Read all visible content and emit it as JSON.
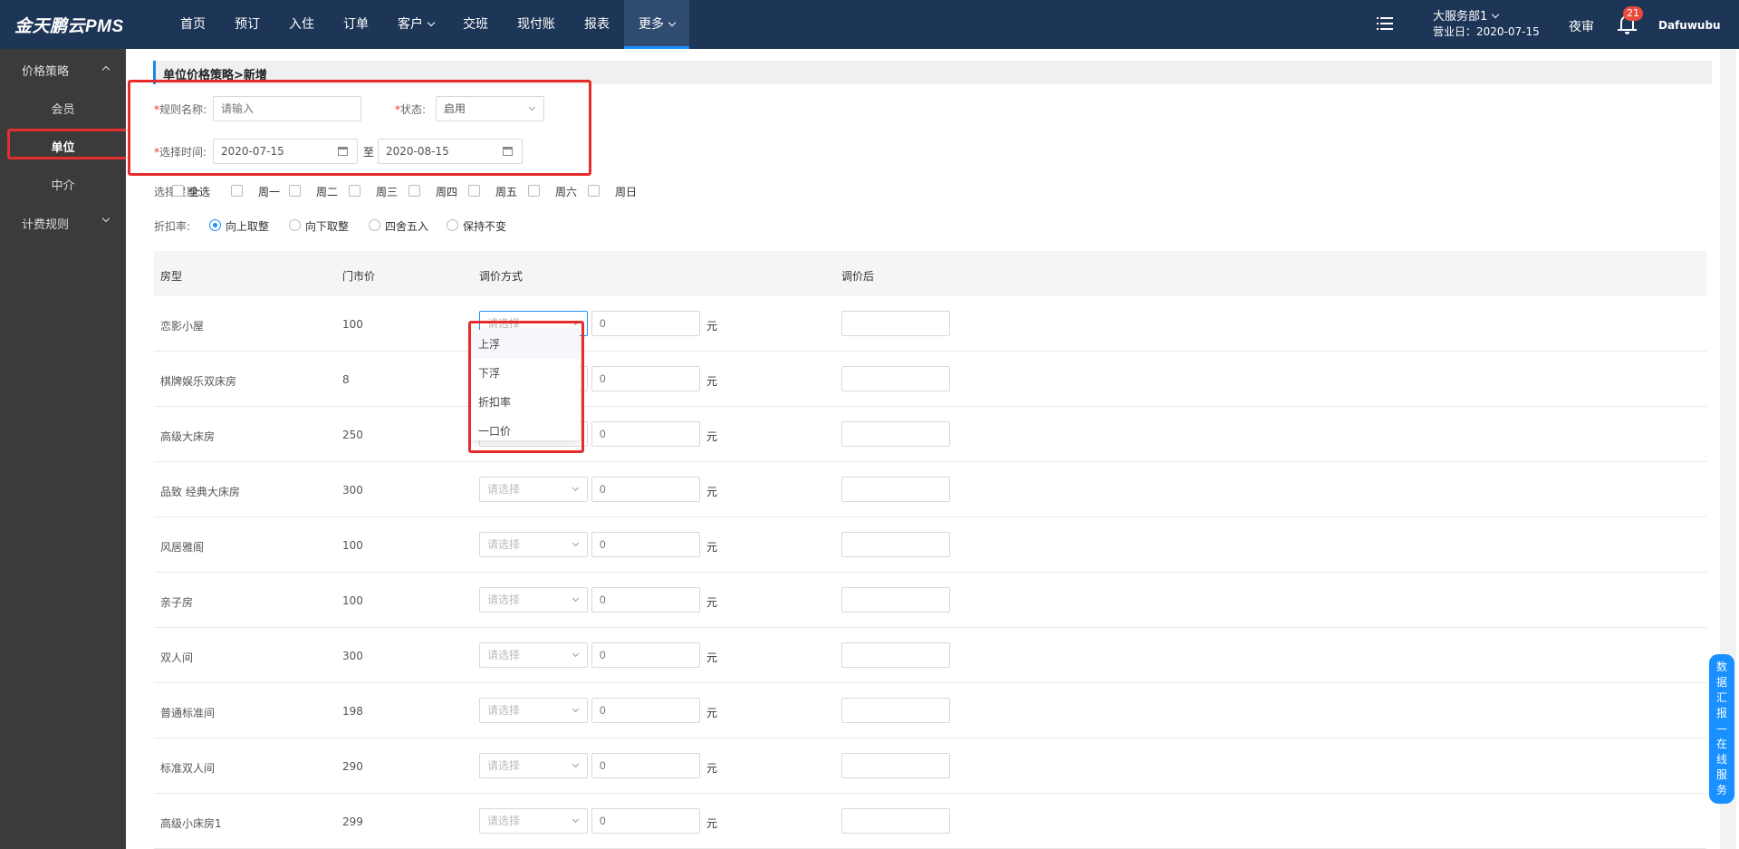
{
  "header": {
    "logo": "金天鹏云PMS",
    "nav": [
      {
        "label": "首页",
        "active": false,
        "dropdown": false
      },
      {
        "label": "预订",
        "active": false,
        "dropdown": false
      },
      {
        "label": "入住",
        "active": false,
        "dropdown": false
      },
      {
        "label": "订单",
        "active": false,
        "dropdown": false
      },
      {
        "label": "客户",
        "active": false,
        "dropdown": true
      },
      {
        "label": "交班",
        "active": false,
        "dropdown": false
      },
      {
        "label": "现付账",
        "active": false,
        "dropdown": false
      },
      {
        "label": "报表",
        "active": false,
        "dropdown": false
      },
      {
        "label": "更多",
        "active": true,
        "dropdown": true
      }
    ],
    "department": "大服务部1",
    "business_date": "营业日：2020-07-15",
    "night_audit": "夜审",
    "notification_count": "21",
    "username": "Dafuwubu"
  },
  "sidebar": {
    "group1": "价格策略",
    "items": [
      "会员",
      "单位",
      "中介"
    ],
    "active_item": "单位",
    "group2": "计费规则"
  },
  "breadcrumb": "单位价格策略>新增",
  "form": {
    "rule_name_label": "规则名称:",
    "rule_name_placeholder": "请输入",
    "status_label": "状态:",
    "status_value": "启用",
    "time_label": "选择时间:",
    "start_date": "2020-07-15",
    "to_label": "至",
    "end_date": "2020-08-15",
    "week_label": "选择星期:",
    "week_options": [
      "全选",
      "周一",
      "周二",
      "周三",
      "周四",
      "周五",
      "周六",
      "周日"
    ],
    "discount_label": "折扣率:",
    "rounding_options": [
      "向上取整",
      "向下取整",
      "四舍五入",
      "保持不变"
    ],
    "rounding_selected": "向上取整"
  },
  "table": {
    "headers": [
      "房型",
      "门市价",
      "调价方式",
      "调价后"
    ],
    "select_placeholder": "请选择",
    "amount_placeholder": "0",
    "unit": "元",
    "rows": [
      {
        "room": "恋影小屋",
        "price": "100"
      },
      {
        "room": "棋牌娱乐双床房",
        "price": "8"
      },
      {
        "room": "高级大床房",
        "price": "250"
      },
      {
        "room": "品致 经典大床房",
        "price": "300"
      },
      {
        "room": "风居雅阁",
        "price": "100"
      },
      {
        "room": "亲子房",
        "price": "100"
      },
      {
        "room": "双人间",
        "price": "300"
      },
      {
        "room": "普通标准间",
        "price": "198"
      },
      {
        "room": "标准双人间",
        "price": "290"
      },
      {
        "room": "高级小床房1",
        "price": "299"
      }
    ]
  },
  "dropdown": {
    "options": [
      "上浮",
      "下浮",
      "折扣率",
      "一口价"
    ],
    "hovered": "上浮"
  },
  "float_panel": {
    "chars": [
      "数",
      "据",
      "汇",
      "报",
      "—",
      "在",
      "线",
      "服",
      "务"
    ]
  },
  "colors": {
    "header_bg": "#1d3556",
    "sidebar_bg": "#3b3b3b",
    "accent": "#1890ff",
    "highlight_red": "#e62d2d"
  }
}
